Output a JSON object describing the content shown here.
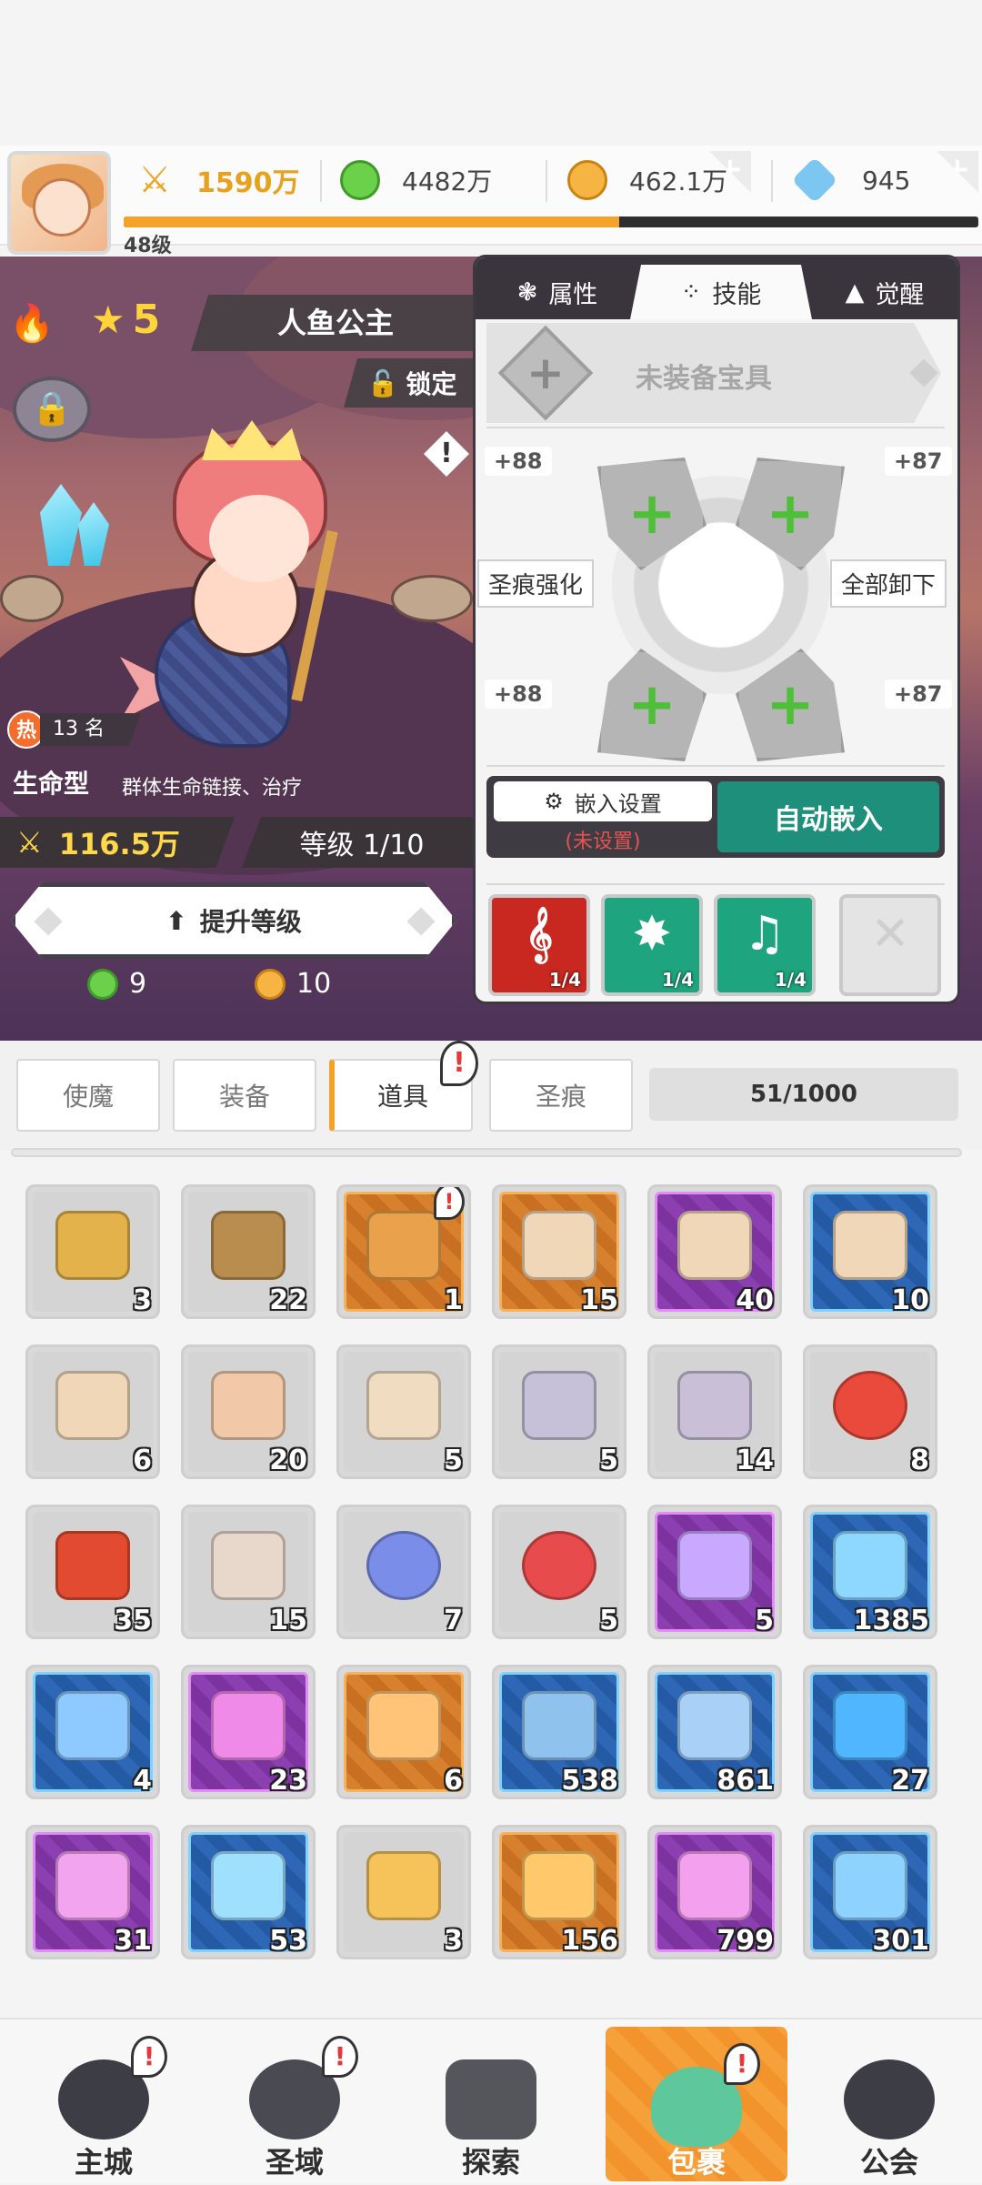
{
  "top_bar": {
    "power": "1590万",
    "green_currency": "4482万",
    "gold_currency": "462.1万",
    "diamond_currency": "945",
    "player_level": "48级",
    "xp_progress": 0.58
  },
  "character": {
    "stars": "5",
    "name": "人鱼公主",
    "lock_label": "锁定",
    "hot_rank": "13 名",
    "hot_label": "热",
    "role": "生命型",
    "role_desc": "群体生命链接、治疗",
    "power": "116.5万",
    "level": "等级 1/10",
    "upgrade_label": "提升等级",
    "cost_green": "9",
    "cost_gold": "10"
  },
  "panel": {
    "tabs": [
      "属性",
      "技能",
      "觉醒"
    ],
    "active_tab": "技能",
    "treasure_label": "未装备宝具",
    "slot_values": {
      "top_left": "+88",
      "top_right": "+87",
      "bottom_left": "+88",
      "bottom_right": "+87"
    },
    "enhance_label": "圣痕强化",
    "unload_label": "全部卸下",
    "embed_settings": "嵌入设置",
    "embed_note": "(未设置)",
    "auto_embed": "自动嵌入",
    "skills": [
      {
        "label": "1/4",
        "color": "#c8281f"
      },
      {
        "label": "1/4",
        "color": "#1ea57f"
      },
      {
        "label": "1/4",
        "color": "#1ea57f"
      },
      {
        "label": "",
        "color": "#dcdcdc"
      }
    ]
  },
  "inventory": {
    "tabs": [
      "使魔",
      "装备",
      "道具",
      "圣痕"
    ],
    "active_tab": "道具",
    "capacity": "51/1000",
    "items": [
      {
        "count": "3",
        "rarity": "gray",
        "icon": "golden-card"
      },
      {
        "count": "22",
        "rarity": "gray",
        "icon": "treasure-chest"
      },
      {
        "count": "1",
        "rarity": "orange",
        "icon": "sword-chest"
      },
      {
        "count": "15",
        "rarity": "orange",
        "icon": "compass-map"
      },
      {
        "count": "40",
        "rarity": "purple",
        "icon": "compass-map"
      },
      {
        "count": "10",
        "rarity": "blue",
        "icon": "compass-map"
      },
      {
        "count": "6",
        "rarity": "gray",
        "icon": "compass-map"
      },
      {
        "count": "20",
        "rarity": "gray",
        "icon": "portrait-map"
      },
      {
        "count": "5",
        "rarity": "gray",
        "icon": "scroll"
      },
      {
        "count": "5",
        "rarity": "gray",
        "icon": "crystal-ring"
      },
      {
        "count": "14",
        "rarity": "gray",
        "icon": "crystal-shard"
      },
      {
        "count": "8",
        "rarity": "gray",
        "icon": "heart"
      },
      {
        "count": "35",
        "rarity": "gray",
        "icon": "red-scroll"
      },
      {
        "count": "15",
        "rarity": "gray",
        "icon": "shell-scroll"
      },
      {
        "count": "7",
        "rarity": "gray",
        "icon": "blue-orb"
      },
      {
        "count": "5",
        "rarity": "gray",
        "icon": "red-orb"
      },
      {
        "count": "5",
        "rarity": "purple",
        "icon": "purple-gem"
      },
      {
        "count": "1385",
        "rarity": "blue",
        "icon": "blue-gem"
      },
      {
        "count": "4",
        "rarity": "blue",
        "icon": "blue-ore"
      },
      {
        "count": "23",
        "rarity": "purple",
        "icon": "pink-ore"
      },
      {
        "count": "6",
        "rarity": "orange",
        "icon": "orange-ore"
      },
      {
        "count": "538",
        "rarity": "blue",
        "icon": "blueprint"
      },
      {
        "count": "861",
        "rarity": "blue",
        "icon": "bandage"
      },
      {
        "count": "27",
        "rarity": "blue",
        "icon": "blue-flame"
      },
      {
        "count": "31",
        "rarity": "purple",
        "icon": "pink-crystals"
      },
      {
        "count": "53",
        "rarity": "blue",
        "icon": "blue-crystals"
      },
      {
        "count": "3",
        "rarity": "gray",
        "icon": "gold-cubes"
      },
      {
        "count": "156",
        "rarity": "orange",
        "icon": "gold-ingot"
      },
      {
        "count": "799",
        "rarity": "purple",
        "icon": "pink-ingot"
      },
      {
        "count": "301",
        "rarity": "blue",
        "icon": "blue-ingot"
      }
    ]
  },
  "bottom_nav": [
    {
      "label": "主城",
      "alert": true
    },
    {
      "label": "圣域",
      "alert": true
    },
    {
      "label": "探索",
      "alert": false
    },
    {
      "label": "包裹",
      "alert": true,
      "active": true
    },
    {
      "label": "公会",
      "alert": false
    }
  ],
  "colors": {
    "accent_orange": "#f3a32a",
    "teal_button": "#1e8f7a",
    "panel_dark": "#3a353c"
  }
}
